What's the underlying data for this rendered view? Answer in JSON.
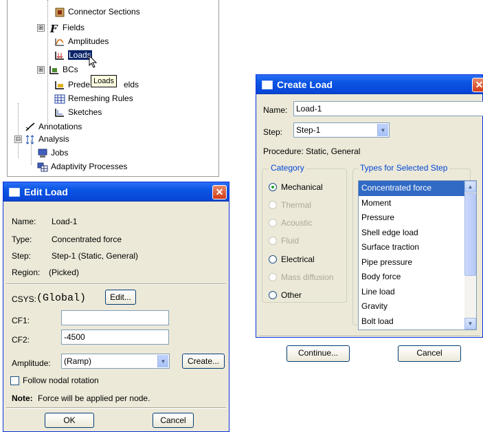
{
  "tree": {
    "items": [
      {
        "label": "Connector Sections",
        "icon": "connector-sections-icon"
      },
      {
        "label": "Fields",
        "icon": "fields-icon"
      },
      {
        "label": "Amplitudes",
        "icon": "amplitudes-icon"
      },
      {
        "label": "Loads",
        "icon": "loads-icon"
      },
      {
        "label": "BCs",
        "icon": "bcs-icon"
      },
      {
        "label": "Prede",
        "label_tail": "elds",
        "icon": "predefined-fields-icon"
      },
      {
        "label": "Remeshing Rules",
        "icon": "remeshing-rules-icon"
      },
      {
        "label": "Sketches",
        "icon": "sketches-icon"
      },
      {
        "label": "Annotations",
        "icon": "annotations-icon"
      },
      {
        "label": "Analysis",
        "icon": "analysis-icon"
      },
      {
        "label": "Jobs",
        "icon": "jobs-icon"
      },
      {
        "label": "Adaptivity Processes",
        "icon": "adaptivity-processes-icon"
      }
    ],
    "tooltip": "Loads",
    "expander_symbol": "⊞",
    "collapser_symbol": "⊟"
  },
  "edit_load": {
    "title": "Edit Load",
    "name_label": "Name:",
    "name_value": "Load-1",
    "type_label": "Type:",
    "type_value": "Concentrated force",
    "step_label": "Step:",
    "step_value": "Step-1 (Static, General)",
    "region_label": "Region:",
    "region_value": "(Picked)",
    "csys_label": "CSYS:",
    "csys_value": "(Global)",
    "csys_edit": "Edit...",
    "cf1_label": "CF1:",
    "cf1_value": "",
    "cf2_label": "CF2:",
    "cf2_value": "-4500",
    "amplitude_label": "Amplitude:",
    "amplitude_value": "(Ramp)",
    "amplitude_create": "Create...",
    "follow_label": "Follow nodal rotation",
    "note_bold": "Note:",
    "note_text": "Force will be applied per node.",
    "ok": "OK",
    "cancel": "Cancel"
  },
  "create_load": {
    "title": "Create Load",
    "name_label": "Name:",
    "name_value": "Load-1",
    "step_label": "Step:",
    "step_value": "Step-1",
    "procedure": "Procedure:  Static, General",
    "category_title": "Category",
    "categories": [
      {
        "label": "Mechanical",
        "selected": true,
        "enabled": true
      },
      {
        "label": "Thermal",
        "selected": false,
        "enabled": false
      },
      {
        "label": "Acoustic",
        "selected": false,
        "enabled": false
      },
      {
        "label": "Fluid",
        "selected": false,
        "enabled": false
      },
      {
        "label": "Electrical",
        "selected": false,
        "enabled": true
      },
      {
        "label": "Mass diffusion",
        "selected": false,
        "enabled": false
      },
      {
        "label": "Other",
        "selected": false,
        "enabled": true
      }
    ],
    "types_title": "Types for Selected Step",
    "types": [
      "Concentrated force",
      "Moment",
      "Pressure",
      "Shell edge load",
      "Surface traction",
      "Pipe pressure",
      "Body force",
      "Line load",
      "Gravity",
      "Bolt load"
    ],
    "selected_type": "Concentrated force",
    "continue": "Continue...",
    "cancel": "Cancel"
  },
  "colors": {
    "titlebar": "#0a54e3",
    "dialog_bg": "#ece9d8",
    "selection": "#316ac5",
    "tree_selection": "#0a246a",
    "close_button": "#d43b16"
  }
}
